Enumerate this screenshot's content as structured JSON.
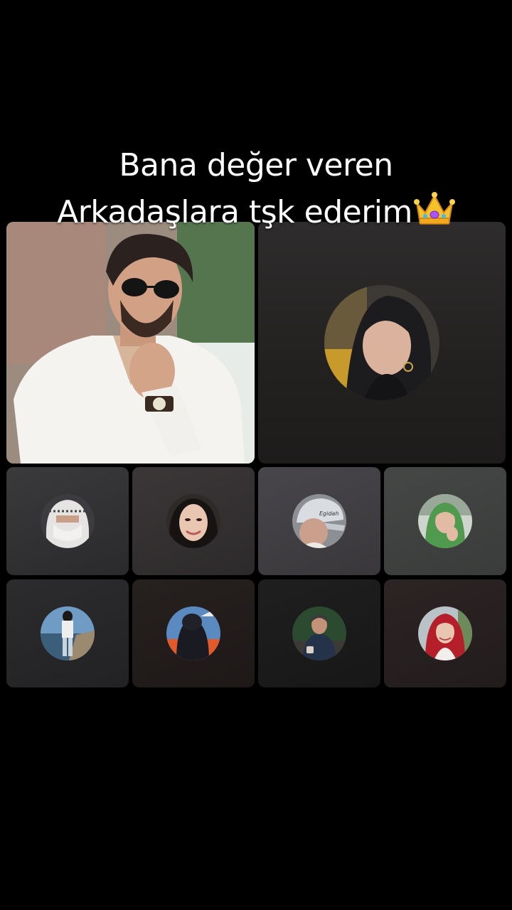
{
  "caption": {
    "line1": "Bana değer veren",
    "line2": "Arkadaşlara tşk ederim"
  },
  "icons": {
    "caption_emoji": "crown-icon"
  },
  "colors": {
    "background": "#000000",
    "caption_text": "#ffffff",
    "tile_background": "#2a2a2c"
  }
}
